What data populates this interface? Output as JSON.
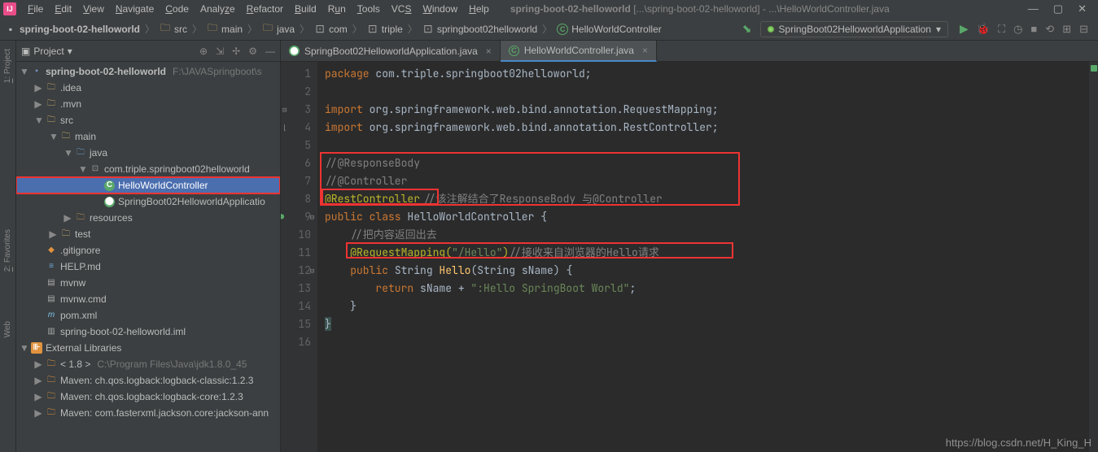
{
  "menu": [
    "File",
    "Edit",
    "View",
    "Navigate",
    "Code",
    "Analyze",
    "Refactor",
    "Build",
    "Run",
    "Tools",
    "VCS",
    "Window",
    "Help"
  ],
  "title_app": "spring-boot-02-helloworld",
  "title_path": "[...\\spring-boot-02-helloworld] - ...\\HelloWorldController.java",
  "breadcrumbs": [
    {
      "label": "spring-boot-02-helloworld",
      "icon": "module"
    },
    {
      "label": "src",
      "icon": "dir"
    },
    {
      "label": "main",
      "icon": "dir"
    },
    {
      "label": "java",
      "icon": "dir"
    },
    {
      "label": "com",
      "icon": "pkg"
    },
    {
      "label": "triple",
      "icon": "pkg"
    },
    {
      "label": "springboot02helloworld",
      "icon": "pkg"
    },
    {
      "label": "HelloWorldController",
      "icon": "class"
    }
  ],
  "run_config": "SpringBoot02HelloworldApplication",
  "side_tabs": [
    "1: Project",
    "2: Favorites",
    "Web"
  ],
  "panel_title": "Project",
  "tree": {
    "root": {
      "name": "spring-boot-02-helloworld",
      "extra": "F:\\JAVASpringboot\\s"
    },
    "idea": ".idea",
    "mvn": ".mvn",
    "src": "src",
    "main": "main",
    "java": "java",
    "pkg": "com.triple.springboot02helloworld",
    "sel": "HelloWorldController",
    "app": "SpringBoot02HelloworldApplicatio",
    "resources": "resources",
    "test": "test",
    "gitignore": ".gitignore",
    "help": "HELP.md",
    "mvnw": "mvnw",
    "mvnwcmd": "mvnw.cmd",
    "pom": "pom.xml",
    "iml": "spring-boot-02-helloworld.iml",
    "extlib": "External Libraries",
    "jdk": "< 1.8 >",
    "jdk_extra": "C:\\Program Files\\Java\\jdk1.8.0_45",
    "m1": "Maven: ch.qos.logback:logback-classic:1.2.3",
    "m2": "Maven: ch.qos.logback:logback-core:1.2.3",
    "m3": "Maven: com.fasterxml.jackson.core:jackson-ann"
  },
  "tabs": [
    {
      "label": "SpringBoot02HelloworldApplication.java",
      "active": false
    },
    {
      "label": "HelloWorldController.java",
      "active": true
    }
  ],
  "code": {
    "l1": {
      "kw": "package ",
      "pkg": "com.triple.springboot02helloworld;"
    },
    "l3a": {
      "kw": "import ",
      "pkg": "org.springframework.web.bind.annotation.",
      "cls": "RequestMapping",
      ";": ";"
    },
    "l3b": {
      "kw": "import ",
      "pkg": "org.springframework.web.bind.annotation.",
      "cls": "RestController",
      ";": ";"
    },
    "l6": "//@ResponseBody",
    "l7": "//@Controller",
    "l8a": "@RestController",
    "l8b": "//该注解结合了ResponseBody 与@Controller",
    "l9": {
      "kw": "public class ",
      "name": "HelloWorldController ",
      "brace": "{"
    },
    "l10": "//把内容返回出去",
    "l11a": "@RequestMapping(",
    "l11b": "\"/Hello\"",
    "l11c": ")",
    "l11d": "//接收来自浏览器的Hello请求",
    "l12": {
      "kw": "public ",
      "type": "String ",
      "name": "Hello",
      "args": "(String sName) {"
    },
    "l13": {
      "kw": "return ",
      "var": "sName + ",
      "str": "\":Hello SpringBoot World\"",
      ";": ";"
    },
    "l14": "}",
    "l15": "}"
  },
  "watermark": "https://blog.csdn.net/H_King_H"
}
